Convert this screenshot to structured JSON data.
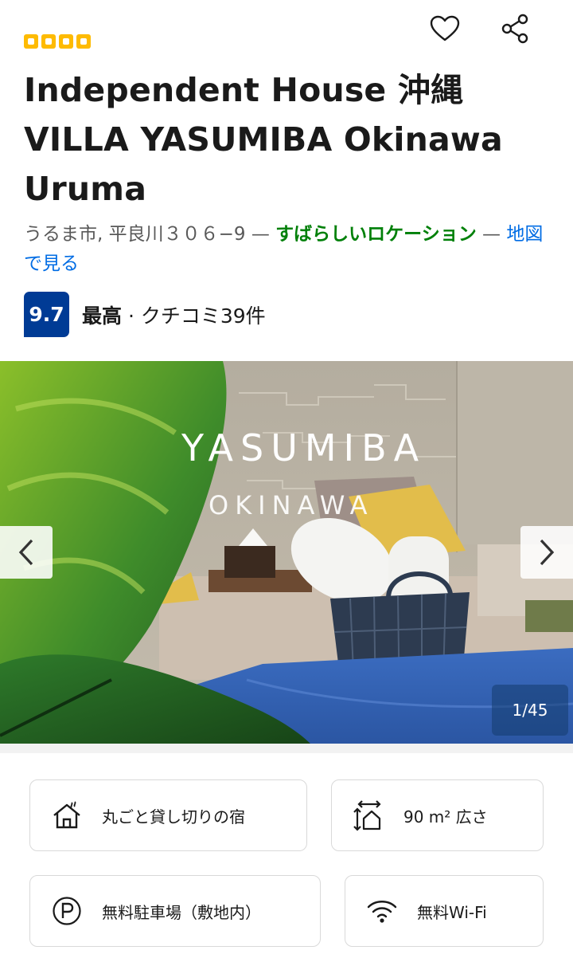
{
  "header": {
    "stars": 4,
    "star_color": "#febb02",
    "favorite_icon": "heart-icon",
    "share_icon": "share-icon"
  },
  "hotel": {
    "title": "Independent House 沖縄 VILLA YASUMIBA Okinawa Uruma",
    "address": "うるま市, 平良川３０６−9",
    "separator": "—",
    "location_badge": "すばらしいロケーション",
    "separator2": "—",
    "map_link": "地図で見る"
  },
  "rating": {
    "score": "9.7",
    "word": "最高",
    "dot": "·",
    "reviews": "クチコミ39件",
    "badge_color": "#003b95"
  },
  "gallery": {
    "overlay_title": "YASUMIBA",
    "overlay_subtitle": "OKINAWA",
    "counter": "1/45",
    "prev_icon": "chevron-left-icon",
    "next_icon": "chevron-right-icon"
  },
  "facilities": [
    {
      "label": "丸ごと貸し切りの宿",
      "icon": "house-icon"
    },
    {
      "label": "90 m² 広さ",
      "icon": "area-size-icon"
    },
    {
      "label": "無料駐車場（敷地内）",
      "icon": "parking-icon"
    },
    {
      "label": "無料Wi-Fi",
      "icon": "wifi-icon"
    }
  ]
}
